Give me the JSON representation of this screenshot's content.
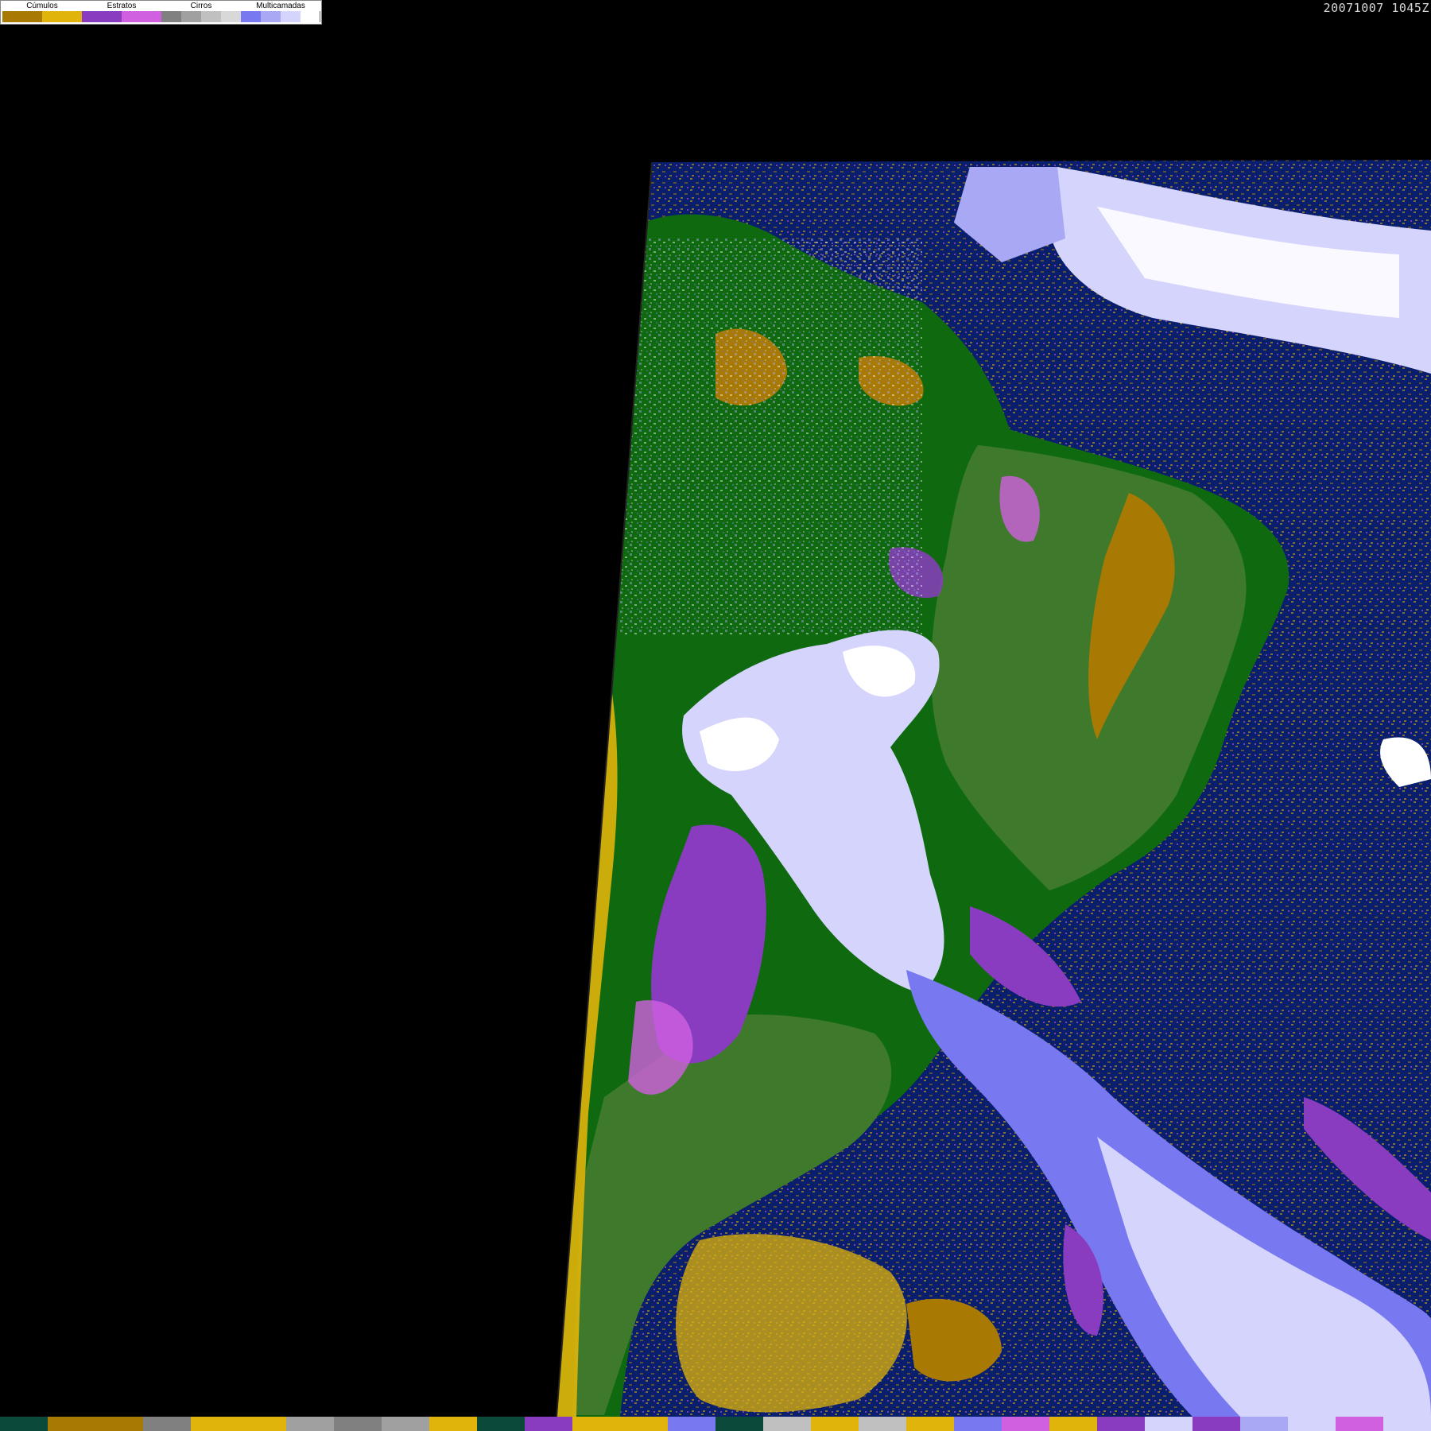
{
  "timestamp": "20071007 1045Z",
  "legend": {
    "groups": [
      {
        "label": "Cúmulos",
        "colors": [
          "#a87a04",
          "#e0b40a"
        ]
      },
      {
        "label": "Estratos",
        "colors": [
          "#8a3cc0",
          "#d060e0"
        ]
      },
      {
        "label": "Cirros",
        "colors": [
          "#808080",
          "#a0a0a0",
          "#c0c0c0",
          "#d8d8d8"
        ]
      },
      {
        "label": "Multicamadas",
        "colors": [
          "#7878f0",
          "#a8a8f4",
          "#d4d4fc",
          "#ffffff"
        ]
      }
    ]
  },
  "map_colors": {
    "space": "#000000",
    "ocean": "#0a1e6e",
    "land_forest": "#0f6a0f",
    "land_savanna": "#3f7a2c",
    "cumulus_low": "#a87a04",
    "cumulus_high": "#e0b40a",
    "stratus_purple": "#8a3cc0",
    "stratus_magenta": "#d060e0",
    "cirrus_gray": "#a0a0a0",
    "multi_blue": "#7878f0",
    "multi_light": "#d4d4fc",
    "multi_white": "#ffffff"
  },
  "bottom_strip": [
    "#0b4a3a",
    "#a87a04",
    "#a87a04",
    "#808080",
    "#e0b40a",
    "#e0b40a",
    "#a0a0a0",
    "#808080",
    "#a0a0a0",
    "#e0b40a",
    "#0b4a3a",
    "#8a3cc0",
    "#e0b40a",
    "#e0b40a",
    "#7878f0",
    "#0b4a3a",
    "#c0c0c0",
    "#e0b40a",
    "#c0c0c0",
    "#e0b40a",
    "#7878f0",
    "#d060e0",
    "#e0b40a",
    "#8a3cc0",
    "#d4d4fc",
    "#8a3cc0",
    "#a8a8f4",
    "#d4d4fc",
    "#d060e0",
    "#d4d4fc"
  ]
}
